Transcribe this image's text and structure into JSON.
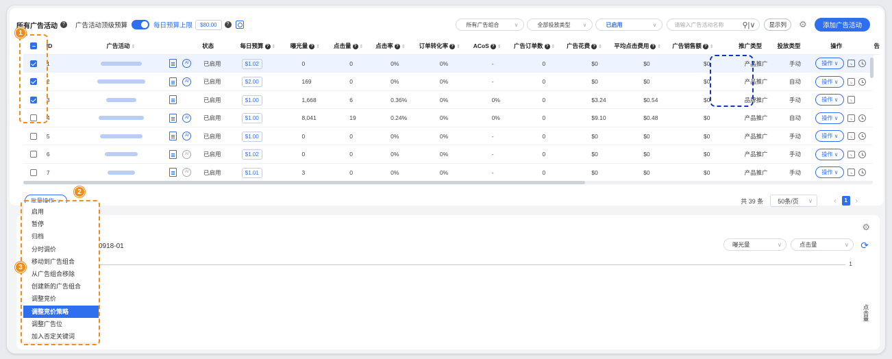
{
  "toolbar": {
    "title": "所有广告活动",
    "top_budget_label": "广告活动顶级预算",
    "daily_budget_link": "每日预算上限",
    "daily_budget_value": "$80.00",
    "filter_portfolio": "所有广告组合",
    "filter_delivery": "全部投放类型",
    "filter_status": "已启用",
    "search_placeholder": "请输入广告活动名称",
    "show_columns": "显示列",
    "add_campaign": "添加广告活动"
  },
  "columns": [
    "ID",
    "广告活动",
    "状态",
    "每日预算",
    "曝光量",
    "点击量",
    "点击率",
    "订单转化率",
    "ACoS",
    "广告订单数",
    "广告花费",
    "平均点击费用",
    "广告销售额",
    "推广类型",
    "投放类型",
    "操作",
    "告"
  ],
  "rows": [
    {
      "id": "1",
      "checked": true,
      "ai": true,
      "status": "已启用",
      "budget": "$1.02",
      "impressions": "0",
      "clicks": "0",
      "ctr": "0%",
      "cvr": "0%",
      "acos": "-",
      "orders": "0",
      "spend": "$0",
      "cpc": "$0",
      "sales": "$0",
      "promo": "产品推广",
      "delivery": "手动",
      "op": "操作"
    },
    {
      "id": "2",
      "checked": true,
      "ai": true,
      "status": "已启用",
      "budget": "$2.00",
      "impressions": "169",
      "clicks": "0",
      "ctr": "0%",
      "cvr": "0%",
      "acos": "-",
      "orders": "0",
      "spend": "$0",
      "cpc": "$0",
      "sales": "$0",
      "promo": "产品推广",
      "delivery": "自动",
      "op": "操作"
    },
    {
      "id": "3",
      "checked": true,
      "ai": false,
      "status": "已启用",
      "budget": "$1.00",
      "impressions": "1,668",
      "clicks": "6",
      "ctr": "0.36%",
      "cvr": "0%",
      "acos": "0%",
      "orders": "0",
      "spend": "$3.24",
      "cpc": "$0.54",
      "sales": "$0",
      "promo": "品牌推广",
      "delivery": "手动",
      "op": "操作"
    },
    {
      "id": "4",
      "checked": false,
      "ai": true,
      "status": "已启用",
      "budget": "$1.00",
      "impressions": "8,041",
      "clicks": "19",
      "ctr": "0.24%",
      "cvr": "0%",
      "acos": "0%",
      "orders": "0",
      "spend": "$9.10",
      "cpc": "$0.48",
      "sales": "$0",
      "promo": "产品推广",
      "delivery": "自动",
      "op": "操作"
    },
    {
      "id": "5",
      "checked": false,
      "ai": true,
      "status": "已启用",
      "budget": "$1.00",
      "impressions": "0",
      "clicks": "0",
      "ctr": "0%",
      "cvr": "0%",
      "acos": "-",
      "orders": "0",
      "spend": "$0",
      "cpc": "$0",
      "sales": "$0",
      "promo": "产品推广",
      "delivery": "手动",
      "op": "操作"
    },
    {
      "id": "6",
      "checked": false,
      "ai": true,
      "status": "已启用",
      "budget": "$1.02",
      "impressions": "0",
      "clicks": "0",
      "ctr": "0%",
      "cvr": "0%",
      "acos": "-",
      "orders": "0",
      "spend": "$0",
      "cpc": "$0",
      "sales": "$0",
      "promo": "产品推广",
      "delivery": "手动",
      "op": "操作"
    },
    {
      "id": "7",
      "checked": false,
      "ai": true,
      "status": "已启用",
      "budget": "$1.01",
      "impressions": "3",
      "clicks": "0",
      "ctr": "0%",
      "cvr": "0%",
      "acos": "-",
      "orders": "0",
      "spend": "$0",
      "cpc": "$0",
      "sales": "$0",
      "promo": "产品推广",
      "delivery": "手动",
      "op": "操作"
    }
  ],
  "footer": {
    "batch_label": "批量操作",
    "total": "共 39 条",
    "page_size": "50条/页",
    "page": "1"
  },
  "batch_menu": [
    "启用",
    "暂停",
    "归档",
    "分时调价",
    "移动到广告组合",
    "从广告组合移除",
    "创建新的广告组合",
    "调整竞价",
    "调整竞价策略",
    "调整广告位",
    "加入否定关键词"
  ],
  "batch_menu_highlight": 8,
  "badges": [
    "1",
    "2",
    "3"
  ],
  "bottom": {
    "campaign_suffix": "0918-01",
    "metric_1": "曝光量",
    "metric_2": "点击量",
    "axis_tick": "1",
    "y_label": "点击量"
  },
  "colors": {
    "accent": "#2f6fed",
    "annotation": "#f28c18",
    "annotation_blue": "#1432c8"
  }
}
